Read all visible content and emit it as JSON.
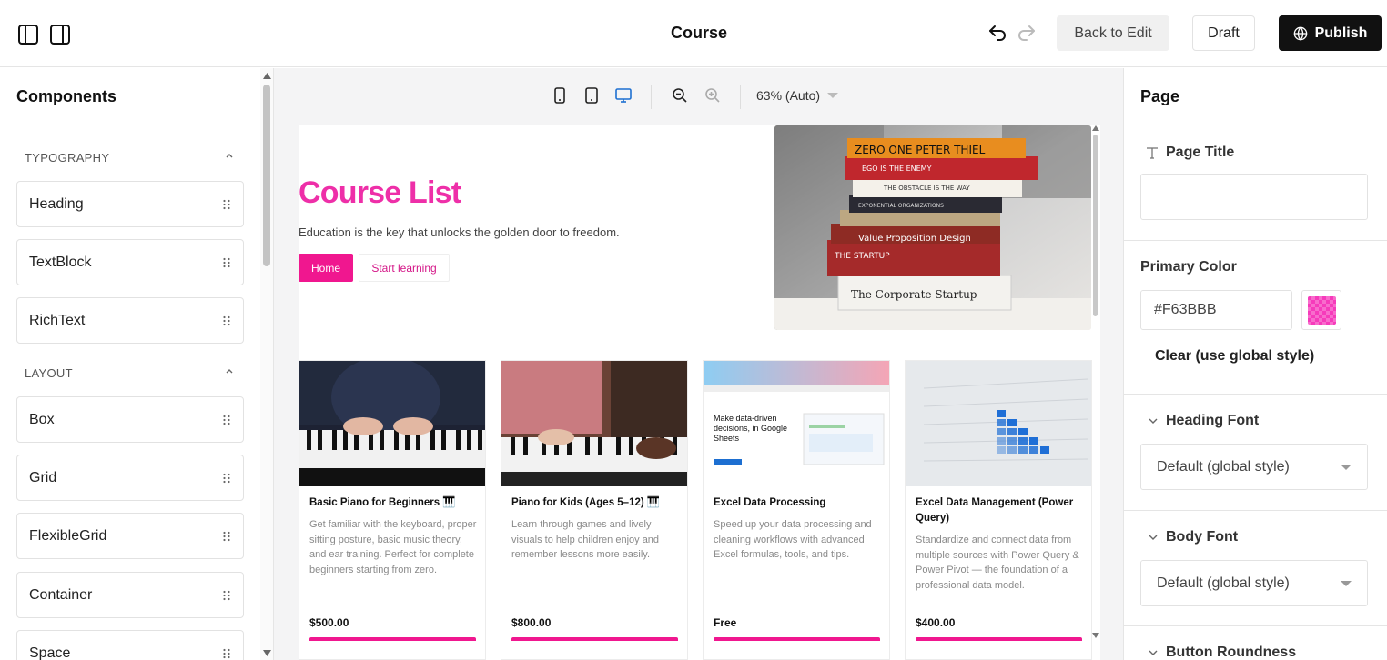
{
  "topbar": {
    "title": "Course",
    "back_label": "Back to Edit",
    "draft_label": "Draft",
    "publish_label": "Publish"
  },
  "left_panel": {
    "title": "Components",
    "sections": [
      {
        "label": "TYPOGRAPHY",
        "items": [
          "Heading",
          "TextBlock",
          "RichText"
        ]
      },
      {
        "label": "LAYOUT",
        "items": [
          "Box",
          "Grid",
          "FlexibleGrid",
          "Container",
          "Space"
        ]
      }
    ]
  },
  "canvas": {
    "zoom_label": "63% (Auto)",
    "hero": {
      "title": "Course List",
      "subtitle": "Education is the key that unlocks the golden door to freedom.",
      "primary_button": "Home",
      "secondary_button": "Start learning"
    },
    "courses": [
      {
        "title": "Basic Piano for Beginners 🎹",
        "desc": "Get familiar with the keyboard, proper sitting posture, basic music theory, and ear training. Perfect for complete beginners starting from zero.",
        "price": "$500.00"
      },
      {
        "title": "Piano for Kids (Ages 5–12) 🎹",
        "desc": "Learn through games and lively visuals to help children enjoy and remember lessons more easily.",
        "price": "$800.00"
      },
      {
        "title": "Excel Data Processing",
        "desc": "Speed up your data processing and cleaning workflows with advanced Excel formulas, tools, and tips.",
        "price": "Free",
        "thumb_text": "Make data-driven decisions, in Google Sheets"
      },
      {
        "title": "Excel Data Management (Power Query)",
        "desc": "Standardize and connect data from multiple sources with Power Query & Power Pivot — the foundation of a professional data model.",
        "price": "$400.00"
      }
    ]
  },
  "right_panel": {
    "title": "Page",
    "page_title_label": "Page Title",
    "page_title_value": "",
    "primary_color_label": "Primary Color",
    "primary_color_value": "#F63BBB",
    "clear_label": "Clear (use global style)",
    "heading_font_label": "Heading Font",
    "heading_font_value": "Default (global style)",
    "body_font_label": "Body Font",
    "body_font_value": "Default (global style)",
    "button_roundness_label": "Button Roundness"
  },
  "colors": {
    "accent": "#F0178F",
    "primary": "#F63BBB",
    "publish_bg": "#111111"
  }
}
